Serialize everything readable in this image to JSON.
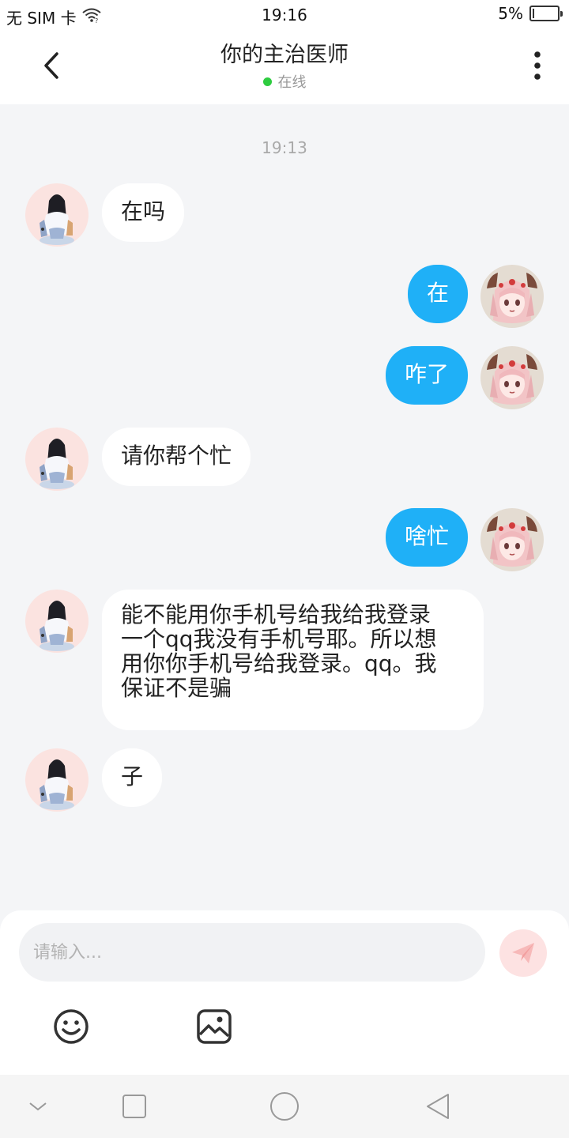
{
  "status_bar": {
    "carrier": "无 SIM 卡",
    "time": "19:16",
    "battery_text": "5%",
    "battery_level": 0.05
  },
  "header": {
    "title": "你的主治医师",
    "status": "在线",
    "status_color": "#2ecc40"
  },
  "chat": {
    "timestamp": "19:13",
    "messages": [
      {
        "side": "in",
        "text": "在吗"
      },
      {
        "side": "out",
        "text": "在"
      },
      {
        "side": "out",
        "text": "咋了"
      },
      {
        "side": "in",
        "text": "请你帮个忙"
      },
      {
        "side": "out",
        "text": "啥忙"
      },
      {
        "side": "in",
        "lines": [
          "能不能用你手机号给我给我登录",
          "一个qq我没有手机号耶。所以想",
          "用你你手机号给我登录。qq。我",
          "保证不是骗"
        ]
      },
      {
        "side": "in",
        "text": "子"
      }
    ]
  },
  "input": {
    "placeholder": "请输入..."
  },
  "colors": {
    "outgoing_bubble": "#1fb0f7",
    "incoming_bubble": "#ffffff",
    "background": "#f4f5f7"
  },
  "icons": {
    "back": "chevron-left-icon",
    "more": "more-vertical-icon",
    "send": "send-icon",
    "emoji": "smiley-icon",
    "image": "image-icon"
  }
}
